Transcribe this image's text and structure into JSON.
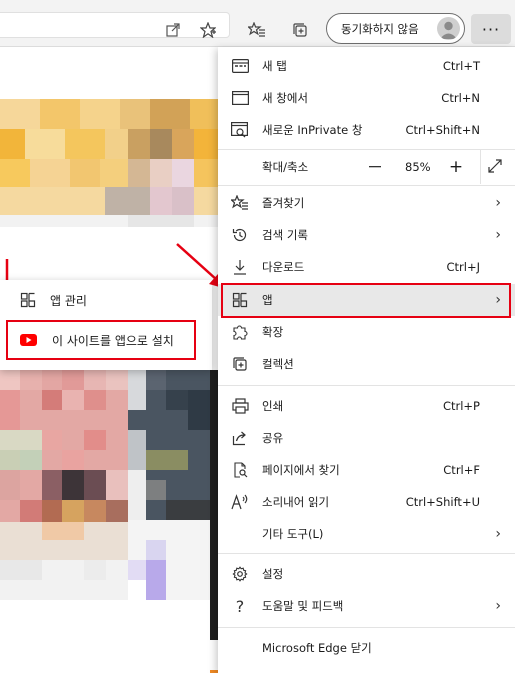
{
  "toolbar": {
    "sync_label": "동기화하지 않음",
    "more_label": "···"
  },
  "menu": {
    "items": [
      {
        "label": "새 탭",
        "shortcut": "Ctrl+T"
      },
      {
        "label": "새 창에서",
        "shortcut": "Ctrl+N"
      },
      {
        "label": "새로운 InPrivate 창",
        "shortcut": "Ctrl+Shift+N"
      },
      {
        "label": "확대/축소",
        "zoom": "85%",
        "minus": "—",
        "plus": "+"
      },
      {
        "label": "즐겨찾기"
      },
      {
        "label": "검색 기록"
      },
      {
        "label": "다운로드",
        "shortcut": "Ctrl+J"
      },
      {
        "label": "앱"
      },
      {
        "label": "확장"
      },
      {
        "label": "컬렉션"
      },
      {
        "label": "인쇄",
        "shortcut": "Ctrl+P"
      },
      {
        "label": "공유"
      },
      {
        "label": "페이지에서 찾기",
        "shortcut": "Ctrl+F"
      },
      {
        "label": "소리내어 읽기",
        "shortcut": "Ctrl+Shift+U"
      },
      {
        "label": "기타 도구(L)"
      },
      {
        "label": "설정"
      },
      {
        "label": "도움말 및 피드백"
      },
      {
        "label": "Microsoft Edge 닫기"
      }
    ]
  },
  "submenu": {
    "manage_label": "앱 관리",
    "install_label": "이 사이트를 앱으로 설치"
  },
  "colors": {
    "highlight_box": "#e60012",
    "youtube_red": "#ff0000"
  }
}
